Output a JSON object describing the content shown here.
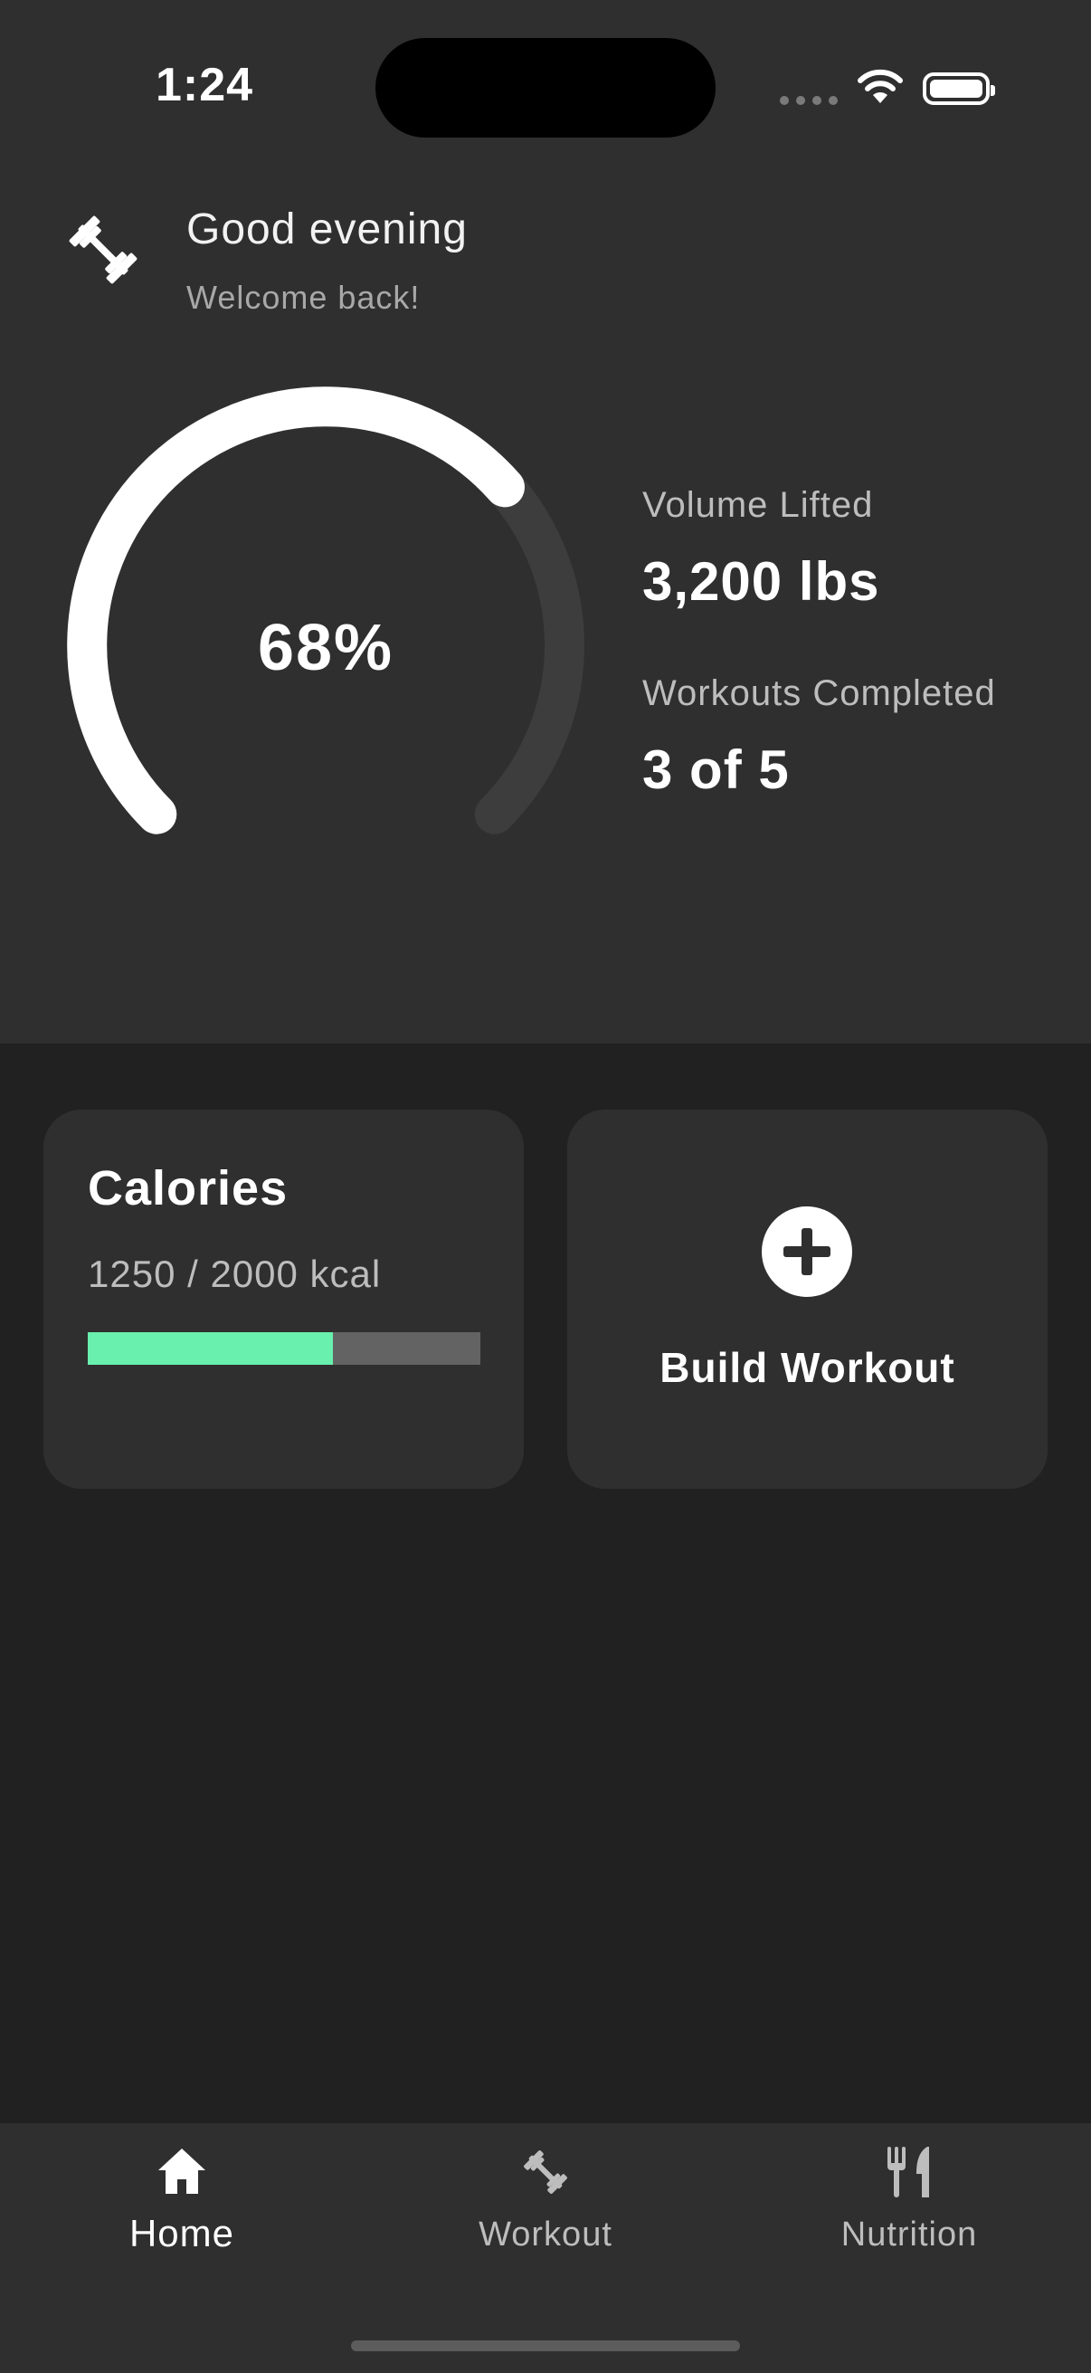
{
  "status_bar": {
    "time": "1:24"
  },
  "header": {
    "greeting": "Good evening",
    "subtitle": "Welcome back!",
    "logo_icon": "dumbbell-icon"
  },
  "progress": {
    "percent_label": "68%",
    "percent": 0.68
  },
  "stats": {
    "volume_label": "Volume Lifted",
    "volume_value": "3,200 lbs",
    "workouts_label": "Workouts Completed",
    "workouts_value": "3 of 5"
  },
  "calories_card": {
    "title": "Calories",
    "value": "1250 / 2000 kcal",
    "progress": 0.625
  },
  "build_card": {
    "label": "Build Workout",
    "icon": "plus-circle-icon"
  },
  "nav": {
    "items": [
      {
        "label": "Home",
        "icon": "home-icon",
        "active": true
      },
      {
        "label": "Workout",
        "icon": "dumbbell-icon",
        "active": false
      },
      {
        "label": "Nutrition",
        "icon": "fork-knife-icon",
        "active": false
      }
    ]
  },
  "colors": {
    "background": "#212121",
    "surface": "#2f2f2f",
    "accent": "#69f0ae",
    "track": "#3d3d3d"
  }
}
